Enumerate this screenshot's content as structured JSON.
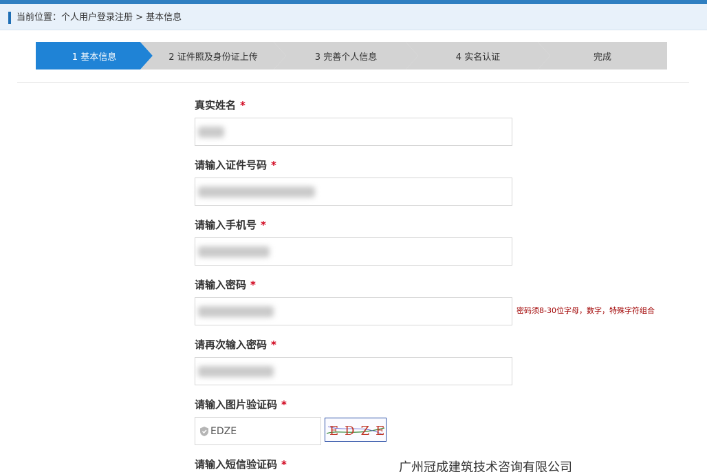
{
  "breadcrumb": {
    "text": "当前位置：个人用户登录注册 > 基本信息"
  },
  "steps": [
    {
      "label": "1 基本信息",
      "active": true
    },
    {
      "label": "2 证件照及身份证上传",
      "active": false
    },
    {
      "label": "3 完善个人信息",
      "active": false
    },
    {
      "label": "4 实名认证",
      "active": false
    },
    {
      "label": "完成",
      "active": false
    }
  ],
  "form": {
    "name_label": "真实姓名",
    "id_label": "请输入证件号码",
    "phone_label": "请输入手机号",
    "password_label": "请输入密码",
    "password_hint": "密码须8-30位字母，数字，特殊字符组合",
    "password2_label": "请再次输入密码",
    "captcha_label": "请输入图片验证码",
    "captcha_value": "EDZE",
    "captcha_image_text": "EDZE",
    "sms_label": "请输入短信验证码",
    "required_mark": "*"
  },
  "watermark": {
    "text": "广州冠成建筑技术咨询有限公司"
  },
  "colors": {
    "accent": "#1f83d6",
    "inactive_step": "#d3d3d3",
    "required": "#d0021b",
    "hint": "#a00000"
  },
  "icons": {
    "captcha_prefix": "shield-icon"
  }
}
